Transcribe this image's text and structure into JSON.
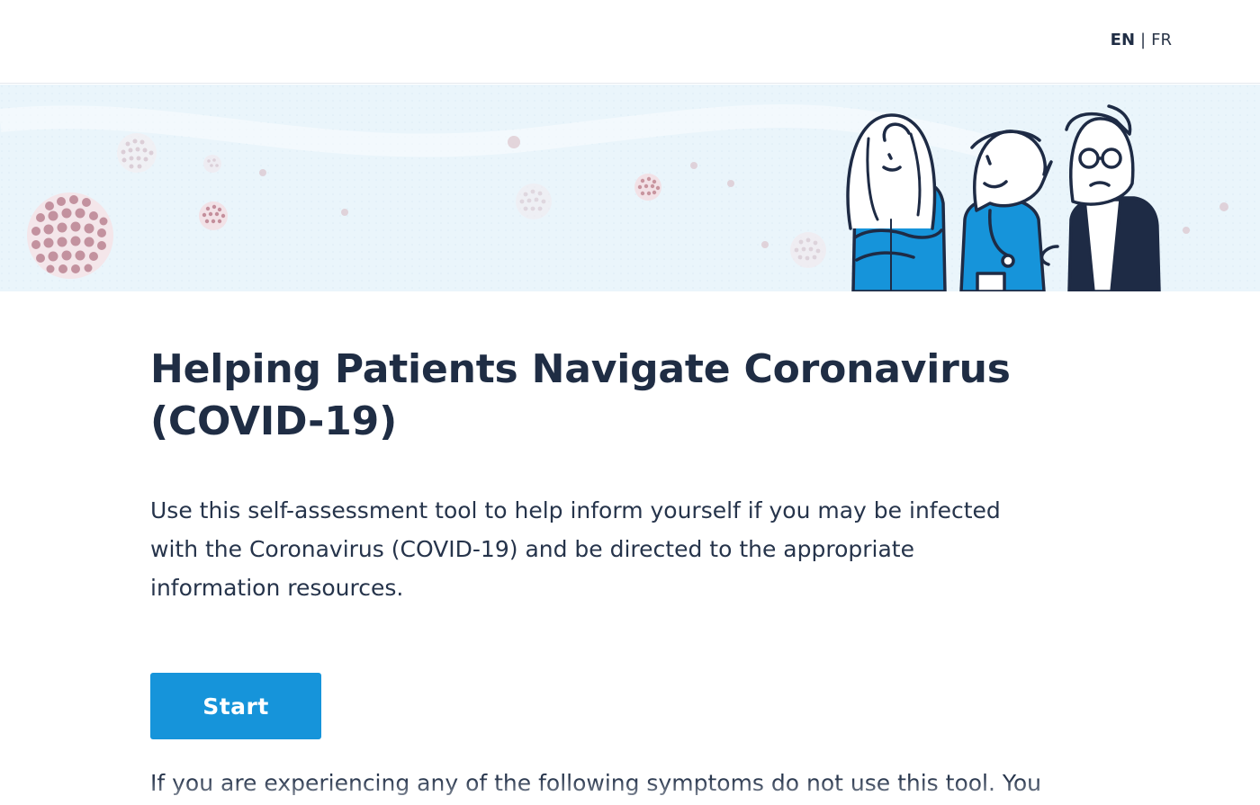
{
  "header": {
    "lang_active": "EN",
    "lang_separator": "|",
    "lang_other": "FR"
  },
  "banner": {
    "illustration": "three-people-virus-illustration"
  },
  "main": {
    "title": "Helping Patients Navigate Coronavirus (COVID-19)",
    "intro": "Use this self-assessment tool to help inform yourself if you may be infected with the Coronavirus (COVID-19) and be directed to the appropriate information resources.",
    "start_label": "Start",
    "warning": "If you are experiencing any of the following symptoms do not use this tool. You"
  },
  "colors": {
    "accent": "#1694da",
    "text": "#1f2d44",
    "banner_bg": "#e9f4fb",
    "virus": "#c79aa8"
  }
}
